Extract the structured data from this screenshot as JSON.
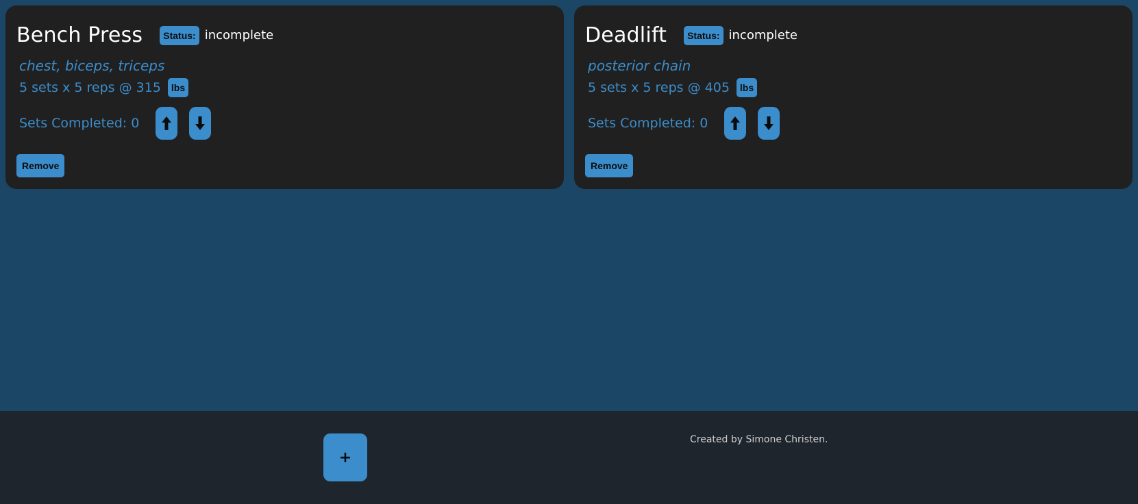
{
  "colors": {
    "background": "#1b4666",
    "card": "#202020",
    "accent": "#3c8dcb",
    "footer": "#1f252c",
    "title_text": "#ffffff"
  },
  "exercises": [
    {
      "name": "Bench Press",
      "status_label": "Status:",
      "status_value": "incomplete",
      "muscles": "chest, biceps, triceps",
      "sets_text": "5 sets x 5 reps @ 315",
      "unit": "lbs",
      "completed_text": "Sets Completed: 0",
      "up_icon": "arrow-up-icon",
      "down_icon": "arrow-down-icon",
      "remove_label": "Remove"
    },
    {
      "name": "Deadlift",
      "status_label": "Status:",
      "status_value": "incomplete",
      "muscles": "posterior chain",
      "sets_text": "5 sets x 5 reps @ 405",
      "unit": "lbs",
      "completed_text": "Sets Completed: 0",
      "up_icon": "arrow-up-icon",
      "down_icon": "arrow-down-icon",
      "remove_label": "Remove"
    }
  ],
  "footer": {
    "add_label": "+",
    "credit": "Created by Simone Christen."
  }
}
